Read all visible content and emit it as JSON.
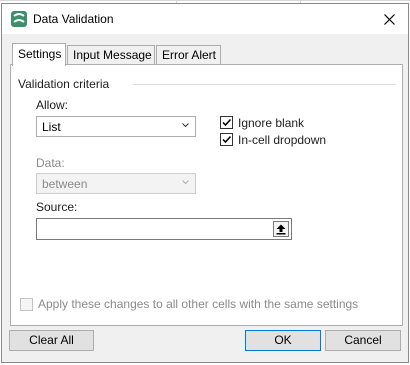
{
  "window": {
    "title": "Data Validation",
    "close_icon": "close-icon",
    "app_icon": "app-logo-icon"
  },
  "tabs": [
    {
      "label": "Settings",
      "active": true
    },
    {
      "label": "Input Message",
      "active": false
    },
    {
      "label": "Error Alert",
      "active": false
    }
  ],
  "criteria": {
    "group_title": "Validation criteria",
    "allow": {
      "label": "Allow:",
      "value": "List"
    },
    "ignore_blank": {
      "label": "Ignore blank",
      "checked": true
    },
    "in_cell_dropdown": {
      "label": "In-cell dropdown",
      "checked": true
    },
    "data": {
      "label": "Data:",
      "value": "between",
      "disabled": true
    },
    "source": {
      "label": "Source:",
      "value": "",
      "button_icon": "collapse-dialog-icon"
    }
  },
  "apply_all": {
    "label": "Apply these changes to all other cells with the same settings",
    "checked": false,
    "disabled": true
  },
  "buttons": {
    "clear_all": "Clear All",
    "ok": "OK",
    "cancel": "Cancel"
  },
  "colors": {
    "accent": "#0078d7",
    "logo_green": "#3d8f6b"
  }
}
